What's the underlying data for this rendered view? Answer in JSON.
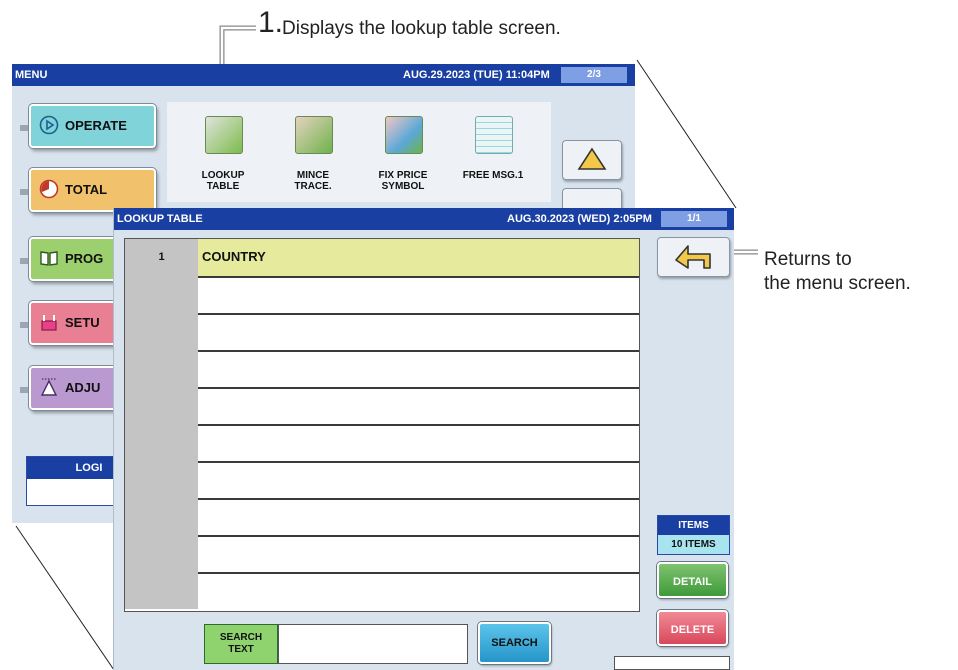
{
  "annotations": {
    "step_number": "1.",
    "step_text": "Displays the lookup table screen.",
    "back_note_line1": "Returns to",
    "back_note_line2": "the menu screen."
  },
  "menu_screen": {
    "title": "MENU",
    "datetime": "AUG.29.2023 (TUE) 11:04PM",
    "page": "2/3",
    "buttons": [
      {
        "label": "OPERATE",
        "color": "#7fd3d9",
        "icon": "play-icon"
      },
      {
        "label": "TOTAL",
        "color": "#f2c16b",
        "icon": "pie-clock-icon"
      },
      {
        "label": "PROG",
        "color": "#9ccf6d",
        "icon": "book-icon"
      },
      {
        "label": "SETU",
        "color": "#e87f93",
        "icon": "tools-icon"
      },
      {
        "label": "ADJU",
        "color": "#b999cf",
        "icon": "scale-icon"
      }
    ],
    "tiles": [
      {
        "line1": "LOOKUP",
        "line2": "TABLE",
        "icon": "map-icon"
      },
      {
        "line1": "MINCE",
        "line2": "TRACE.",
        "icon": "cattle-map-icon"
      },
      {
        "line1": "FIX PRICE",
        "line2": "SYMBOL",
        "icon": "price-tags-icon"
      },
      {
        "line1": "FREE MSG.1",
        "line2": "",
        "icon": "grid-sheet-icon"
      }
    ],
    "login_label": "LOGI"
  },
  "lookup_screen": {
    "title": "LOOKUP TABLE",
    "datetime": "AUG.30.2023 (WED)  2:05PM",
    "page": "1/1",
    "rows": [
      {
        "num": "1",
        "text": "COUNTRY"
      },
      {
        "num": "",
        "text": ""
      },
      {
        "num": "",
        "text": ""
      },
      {
        "num": "",
        "text": ""
      },
      {
        "num": "",
        "text": ""
      },
      {
        "num": "",
        "text": ""
      },
      {
        "num": "",
        "text": ""
      },
      {
        "num": "",
        "text": ""
      },
      {
        "num": "",
        "text": ""
      },
      {
        "num": "",
        "text": ""
      }
    ],
    "items_label": "ITEMS",
    "items_value": "10 ITEMS",
    "detail_label": "DETAIL",
    "delete_label": "DELETE",
    "search_text_label_1": "SEARCH",
    "search_text_label_2": "TEXT",
    "search_value": "",
    "search_button": "SEARCH"
  },
  "colors": {
    "titlebar": "#1a3fa2",
    "screen_bg": "#d9e3ee",
    "selected_row": "#e5ea9c"
  }
}
